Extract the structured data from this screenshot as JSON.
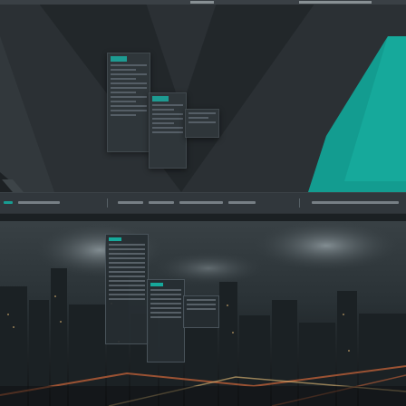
{
  "theme": {
    "accent": "#16a99b",
    "panel_bg": "#31373c",
    "wallpaper_bg": "#2b3034",
    "city_sky": "#2a3236",
    "city_light": "#d2683a"
  },
  "top_desktop": {
    "panel_items": [
      "app-launcher-icon",
      "task-1",
      "task-2",
      "task-3",
      "systray"
    ],
    "menus": [
      "application-menu",
      "submenu",
      "context-menu"
    ]
  },
  "bottom_desktop": {
    "wallpaper": "city-skyline-night",
    "windows": [
      "application-menu",
      "submenu"
    ]
  }
}
